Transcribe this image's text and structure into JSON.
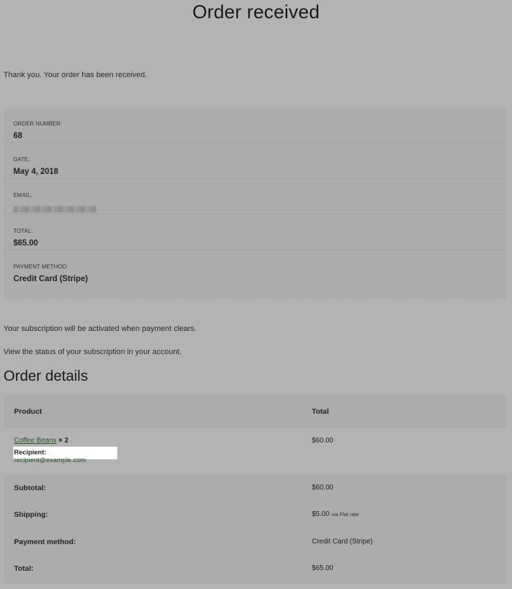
{
  "page": {
    "title": "Order received",
    "thanks": "Thank you. Your order has been received."
  },
  "overview": [
    {
      "label": "ORDER NUMBER:",
      "value": "68"
    },
    {
      "label": "DATE:",
      "value": "May 4, 2018"
    },
    {
      "label": "EMAIL:",
      "value": ""
    },
    {
      "label": "TOTAL:",
      "value": "$65.00"
    },
    {
      "label": "PAYMENT METHOD:",
      "value": "Credit Card (Stripe)"
    }
  ],
  "notes": {
    "subscription": "Your subscription will be activated when payment clears.",
    "status_prefix": "View the status of your subscription in ",
    "status_link": "your account",
    "status_suffix": "."
  },
  "details": {
    "title": "Order details",
    "headers": {
      "product": "Product",
      "total": "Total"
    },
    "item": {
      "name": "Coffee Beans",
      "qty": "× 2",
      "price": "$60.00",
      "recipient_label": "Recipient:",
      "recipient_email": "recipient@example.com"
    },
    "totals": [
      {
        "label": "Subtotal:",
        "value": "$60.00",
        "extra": ""
      },
      {
        "label": "Shipping:",
        "value": "$5.00",
        "extra": "via Flat rate"
      },
      {
        "label": "Payment method:",
        "value": "Credit Card (Stripe)",
        "extra": ""
      },
      {
        "label": "Total:",
        "value": "$65.00",
        "extra": ""
      }
    ]
  }
}
